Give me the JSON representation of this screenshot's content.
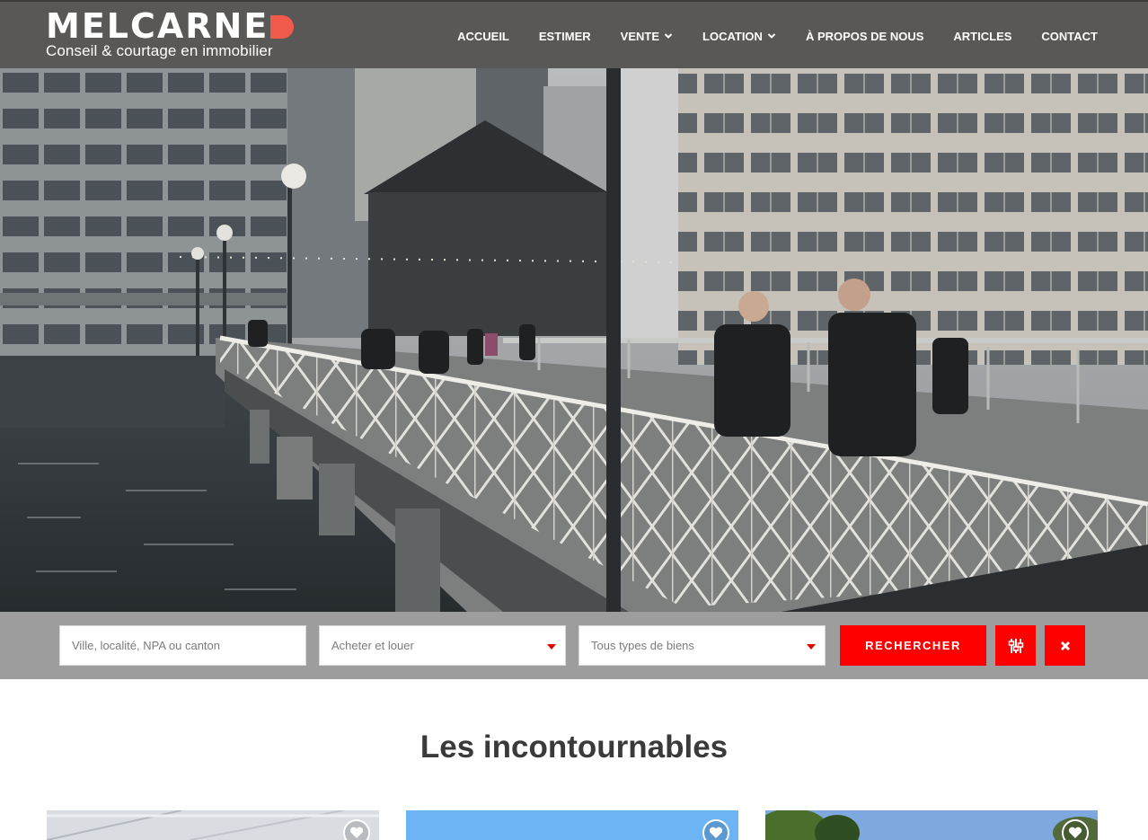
{
  "brand": {
    "name": "MELCARNE",
    "tagline": "Conseil & courtage en immobilier",
    "accent_color": "#ef5a4a"
  },
  "nav": {
    "items": [
      {
        "label": "ACCUEIL",
        "dropdown": false
      },
      {
        "label": "ESTIMER",
        "dropdown": false
      },
      {
        "label": "VENTE",
        "dropdown": true
      },
      {
        "label": "LOCATION",
        "dropdown": true
      },
      {
        "label": "À PROPOS DE NOUS",
        "dropdown": false
      },
      {
        "label": "ARTICLES",
        "dropdown": false
      },
      {
        "label": "CONTACT",
        "dropdown": false
      }
    ]
  },
  "hero": {
    "image": "city-bridge-photo"
  },
  "search": {
    "location_placeholder": "Ville, localité, NPA ou canton",
    "transaction_select": "Acheter et louer",
    "type_select": "Tous types de biens",
    "submit_label": "RECHERCHER",
    "filters_icon": "sliders-icon",
    "reset_icon": "close-icon",
    "button_color": "#ff0000"
  },
  "section": {
    "title": "Les incontournables"
  },
  "cards": [
    {
      "favorite_icon": "heart-icon"
    },
    {
      "favorite_icon": "heart-icon"
    },
    {
      "favorite_icon": "heart-icon"
    }
  ]
}
